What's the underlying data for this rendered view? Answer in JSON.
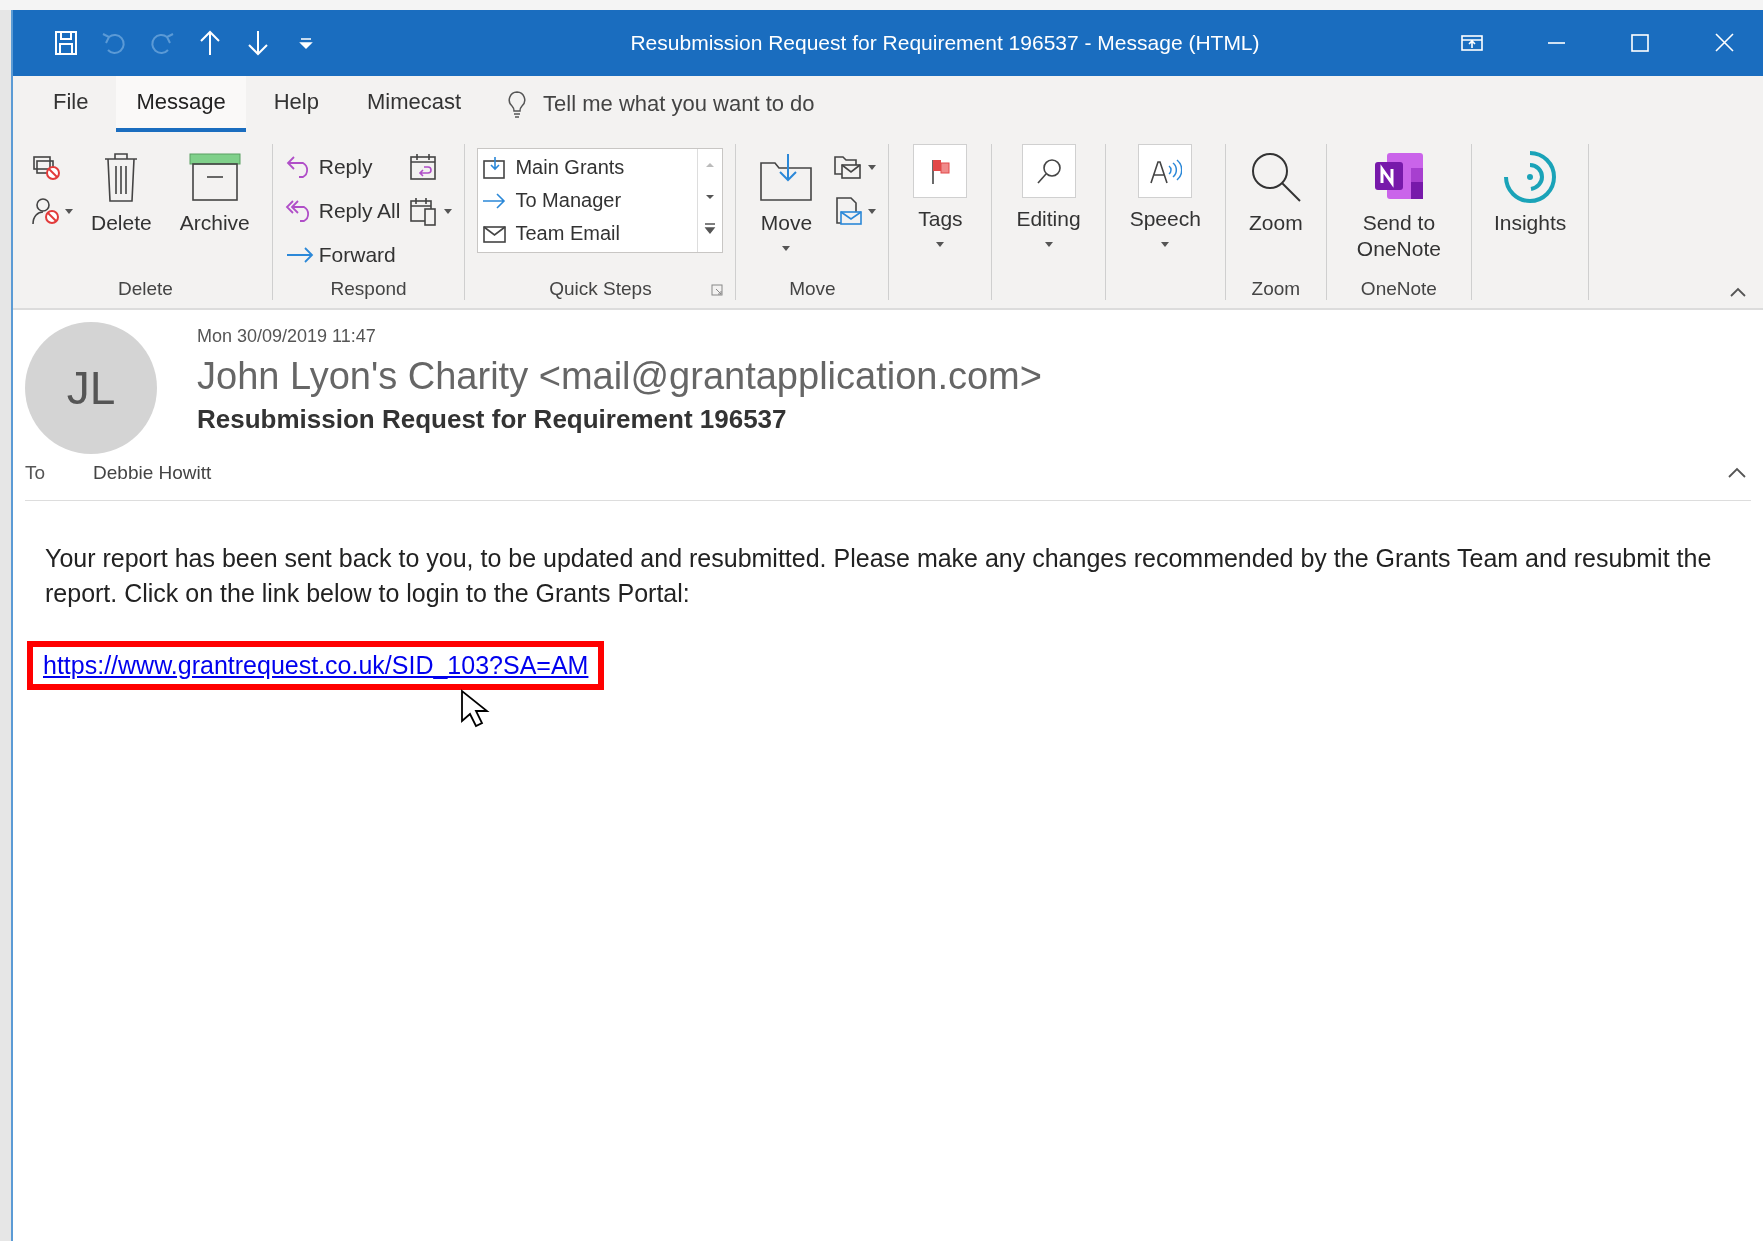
{
  "title_bar": {
    "title": "Resubmission Request for Requirement 196537  -  Message (HTML)",
    "quick_access": [
      {
        "disabled": false
      },
      {
        "disabled": true
      },
      {
        "disabled": true
      },
      {
        "disabled": false
      },
      {
        "disabled": false
      },
      {
        "disabled": false
      }
    ]
  },
  "tabs": [
    {
      "label": "File",
      "selected": false
    },
    {
      "label": "Message",
      "selected": true
    },
    {
      "label": "Help",
      "selected": false
    },
    {
      "label": "Mimecast",
      "selected": false
    }
  ],
  "tell_me": {
    "placeholder": "Tell me what you want to do"
  },
  "ribbon": {
    "groups": [
      {
        "label": "Delete",
        "buttons": [
          {
            "kind": "icon"
          },
          {
            "kind": "icon",
            "menu": true
          },
          {
            "kind": "large",
            "label": "Delete"
          },
          {
            "kind": "large",
            "label": "Archive"
          }
        ]
      },
      {
        "label": "Respond",
        "buttons": [
          {
            "kind": "small",
            "label": "Reply"
          },
          {
            "kind": "small",
            "label": "Reply All"
          },
          {
            "kind": "small",
            "label": "Forward"
          },
          {
            "kind": "icon"
          },
          {
            "kind": "icon",
            "menu": true
          }
        ]
      },
      {
        "label": "Quick Steps",
        "launcher": true,
        "buttons": [
          {
            "kind": "gallery",
            "items": [
              {
                "label": "Main Grants"
              },
              {
                "label": "To Manager"
              },
              {
                "label": "Team Email"
              }
            ]
          }
        ]
      },
      {
        "label": "Move",
        "buttons": [
          {
            "kind": "large",
            "label": "Move",
            "menu": true
          },
          {
            "kind": "icon",
            "menu": true
          },
          {
            "kind": "icon",
            "menu": true
          }
        ]
      },
      {
        "buttons": [
          {
            "kind": "boxed",
            "label": "Tags",
            "menu": true
          }
        ]
      },
      {
        "buttons": [
          {
            "kind": "boxed",
            "label": "Editing",
            "menu": true
          }
        ]
      },
      {
        "buttons": [
          {
            "kind": "boxed",
            "label": "Speech",
            "menu": true
          }
        ]
      },
      {
        "label": "Zoom",
        "buttons": [
          {
            "kind": "large",
            "label": "Zoom"
          }
        ]
      },
      {
        "label": "OneNote",
        "buttons": [
          {
            "kind": "large",
            "label": "Send to OneNote"
          }
        ]
      },
      {
        "buttons": [
          {
            "kind": "large",
            "label": "Insights"
          }
        ]
      }
    ]
  },
  "message": {
    "avatar_initials": "JL",
    "date": "Mon 30/09/2019 11:47",
    "sender": "John Lyon's Charity <mail@grantapplication.com>",
    "subject": "Resubmission Request for Requirement 196537",
    "to_label": "To",
    "to": "Debbie Howitt",
    "body": "Your report has been sent back to you, to be updated and resubmitted. Please make any changes recommended by the Grants Team and resubmit the report. Click on the link below to login to the Grants Portal:",
    "link": "https://www.grantrequest.co.uk/SID_103?SA=AM",
    "link_highlighted": true
  }
}
